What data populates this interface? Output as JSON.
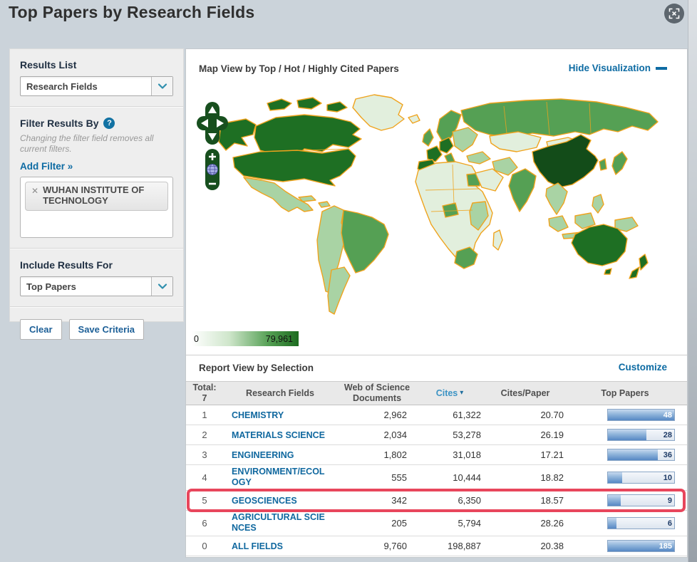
{
  "page": {
    "title": "Top Papers by Research Fields"
  },
  "colors": {
    "accent_blue": "#0d6ba3",
    "link_blue": "#10689f",
    "highlight_red": "#e8465c",
    "map_scale_min_color": "#ffffff",
    "map_scale_max_color": "#1c6b1f",
    "map_border_orange": "#efa31d"
  },
  "sidebar": {
    "results_list": {
      "label": "Results List",
      "selected": "Research Fields"
    },
    "filter": {
      "heading": "Filter Results By",
      "help_icon": "?",
      "note": "Changing the filter field removes all current filters.",
      "add_filter_label": "Add Filter »",
      "chips": [
        {
          "close": "✕",
          "label": "WUHAN INSTITUTE OF TECHNOLOGY"
        }
      ]
    },
    "include_results": {
      "label": "Include Results For",
      "selected": "Top Papers"
    },
    "buttons": {
      "clear": "Clear",
      "save": "Save Criteria"
    }
  },
  "map_section": {
    "title": "Map View by Top / Hot / Highly Cited Papers",
    "hide_link": "Hide Visualization",
    "legend": {
      "min": "0",
      "max": "79,961"
    },
    "controls": {
      "zoom_in": "+",
      "zoom_out": "−"
    }
  },
  "report": {
    "title": "Report View by Selection",
    "customize_link": "Customize",
    "table": {
      "headers": {
        "total_label": "Total:",
        "total_count": "7",
        "fields": "Research Fields",
        "wos_line1": "Web of Science",
        "wos_line2": "Documents",
        "cites": "Cites",
        "sort_arrow": "▾",
        "cites_paper": "Cites/Paper",
        "top_papers": "Top Papers"
      },
      "rows": [
        {
          "rank": "1",
          "field": "CHEMISTRY",
          "wos": "2,962",
          "cites": "61,322",
          "cites_per_paper": "20.70",
          "top_papers": "48",
          "highlight": false
        },
        {
          "rank": "2",
          "field": "MATERIALS SCIENCE",
          "wos": "2,034",
          "cites": "53,278",
          "cites_per_paper": "26.19",
          "top_papers": "28",
          "highlight": false
        },
        {
          "rank": "3",
          "field": "ENGINEERING",
          "wos": "1,802",
          "cites": "31,018",
          "cites_per_paper": "17.21",
          "top_papers": "36",
          "highlight": false
        },
        {
          "rank": "4",
          "field": "ENVIRONMENT/ECOLOGY",
          "wos": "555",
          "cites": "10,444",
          "cites_per_paper": "18.82",
          "top_papers": "10",
          "highlight": false
        },
        {
          "rank": "5",
          "field": "GEOSCIENCES",
          "wos": "342",
          "cites": "6,350",
          "cites_per_paper": "18.57",
          "top_papers": "9",
          "highlight": true
        },
        {
          "rank": "6",
          "field": "AGRICULTURAL SCIENCES",
          "wos": "205",
          "cites": "5,794",
          "cites_per_paper": "28.26",
          "top_papers": "6",
          "highlight": false
        },
        {
          "rank": "0",
          "field": "ALL FIELDS",
          "wos": "9,760",
          "cites": "198,887",
          "cites_per_paper": "20.38",
          "top_papers": "185",
          "highlight": false
        }
      ]
    }
  }
}
